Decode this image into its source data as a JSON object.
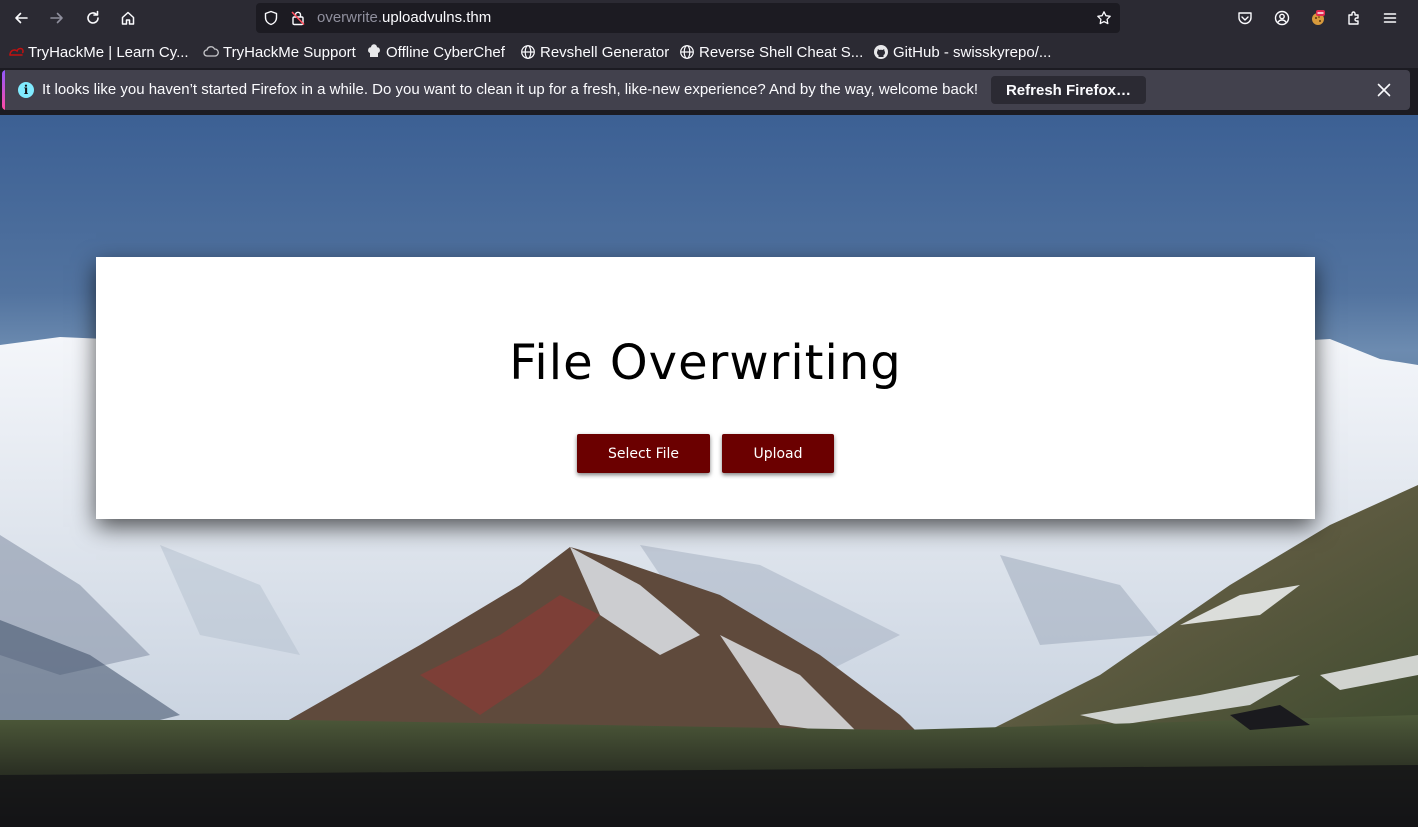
{
  "browser": {
    "url_subdomain": "overwrite.",
    "url_domain": "uploadvulns.thm"
  },
  "bookmarks": [
    {
      "label": "TryHackMe | Learn Cy...",
      "icon": "tryhackme-icon"
    },
    {
      "label": "TryHackMe Support",
      "icon": "cloud-icon"
    },
    {
      "label": "Offline CyberChef",
      "icon": "chef-hat-icon"
    },
    {
      "label": "Revshell Generator",
      "icon": "globe-icon"
    },
    {
      "label": "Reverse Shell Cheat S...",
      "icon": "globe-icon"
    },
    {
      "label": "GitHub - swisskyrepo/...",
      "icon": "github-icon"
    }
  ],
  "notification": {
    "message": "It looks like you haven’t started Firefox in a while. Do you want to clean it up for a fresh, like-new experience? And by the way, welcome back!",
    "button_label": "Refresh Firefox…"
  },
  "page": {
    "title": "File Overwriting",
    "select_button": "Select File",
    "upload_button": "Upload"
  },
  "colors": {
    "button_bg": "#6b0000",
    "toolbar_bg": "#2b2a33",
    "notification_bg": "#42414d"
  }
}
